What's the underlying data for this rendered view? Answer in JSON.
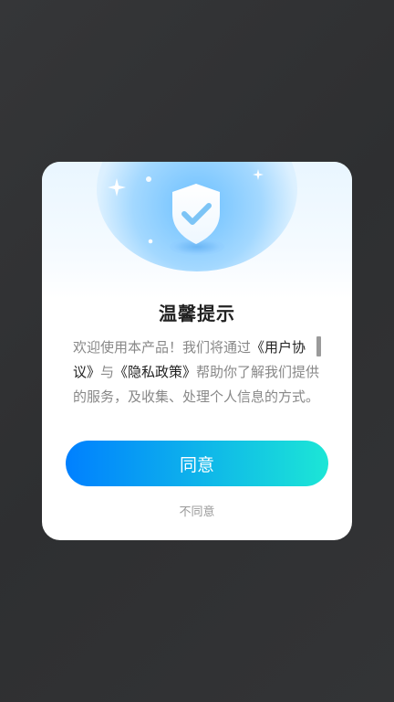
{
  "dialog": {
    "title": "温馨提示",
    "content": {
      "text_1": "欢迎使用本产品！我们将通过",
      "user_agreement_link": "《用户协议》",
      "text_2": "与",
      "privacy_policy_link": "《隐私政策》",
      "text_3": "帮助你了解我们提供的服务，及收集、处理个人信息的方式。"
    },
    "agree_label": "同意",
    "disagree_label": "不同意",
    "icon": "shield-check-icon"
  },
  "colors": {
    "accent_start": "#0080ff",
    "accent_end": "#1ce6d6",
    "title": "#222222",
    "body_text": "#888888"
  }
}
